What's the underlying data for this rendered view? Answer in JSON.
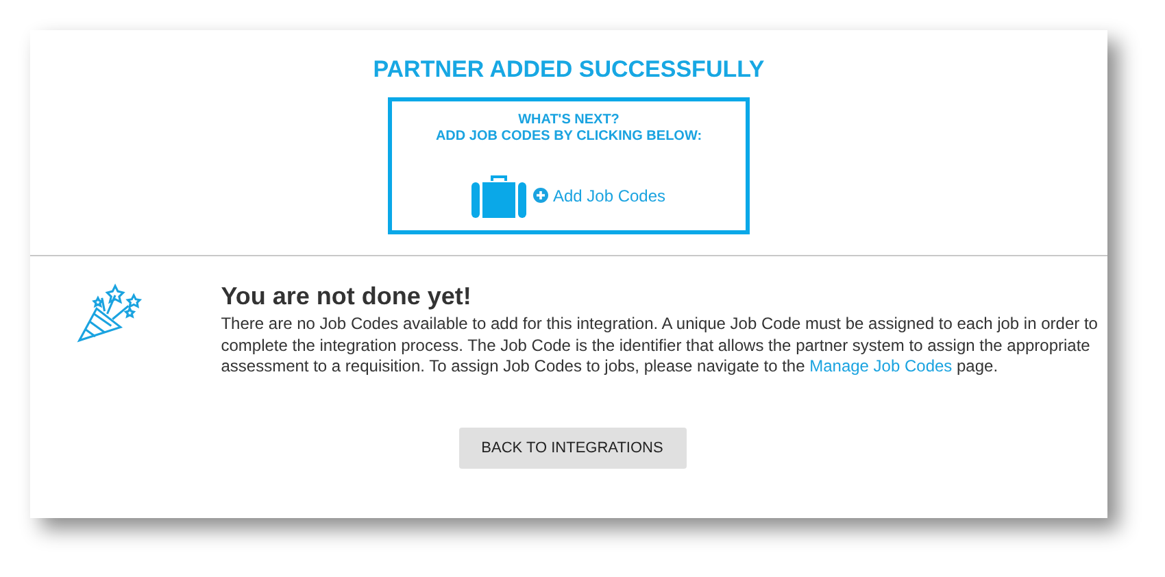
{
  "title": "PARTNER ADDED SUCCESSFULLY",
  "next_box": {
    "lines": [
      "WHAT'S NEXT?",
      "ADD JOB CODES BY CLICKING BELOW:"
    ],
    "link": "Add Job Codes"
  },
  "notice": {
    "heading": "You are not done yet!",
    "text_before": "There are no Job Codes available to add for this integration. A unique Job Code must be assigned to each job in order to complete the integration process. The Job Code is the identifier that allows the partner system to assign the appropriate assessment to a requisition. To assign Job Codes to jobs, please navigate to the",
    "link": "Manage Job Codes",
    "text_after": "page."
  },
  "buttons": [
    "BACK TO INTEGRATIONS"
  ]
}
